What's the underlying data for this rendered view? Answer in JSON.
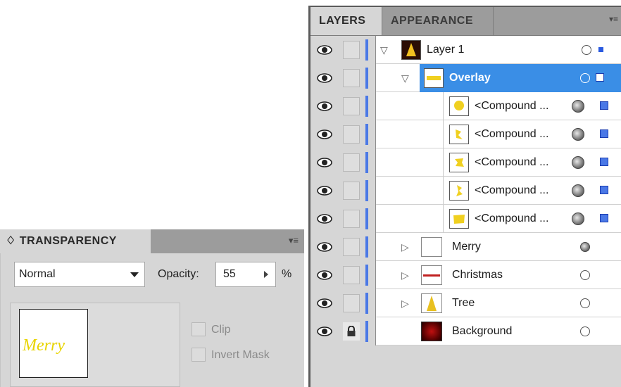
{
  "layers_panel": {
    "tabs": [
      "LAYERS",
      "APPEARANCE"
    ],
    "menu_icon": "panel-menu-icon",
    "rows": [
      {
        "name": "Layer 1"
      },
      {
        "name": "Overlay"
      },
      {
        "name": "<Compound ..."
      },
      {
        "name": "<Compound ..."
      },
      {
        "name": "<Compound ..."
      },
      {
        "name": "<Compound ..."
      },
      {
        "name": "<Compound ..."
      },
      {
        "name": "Merry"
      },
      {
        "name": "Christmas"
      },
      {
        "name": "Tree"
      },
      {
        "name": "Background"
      }
    ]
  },
  "transparency_panel": {
    "title": "TRANSPARENCY",
    "title_prefix": "♢",
    "menu_icon": "panel-menu-icon",
    "blend_mode": "Normal",
    "opacity_label": "Opacity:",
    "opacity_value": "55",
    "percent": "%",
    "preview_text": "Merry",
    "clip_label": "Clip",
    "invert_mask_label": "Invert Mask"
  },
  "colors": {
    "selection_blue": "#3a8ee6",
    "layer_color": "#4a78e6",
    "preview_text": "#e8d400"
  }
}
